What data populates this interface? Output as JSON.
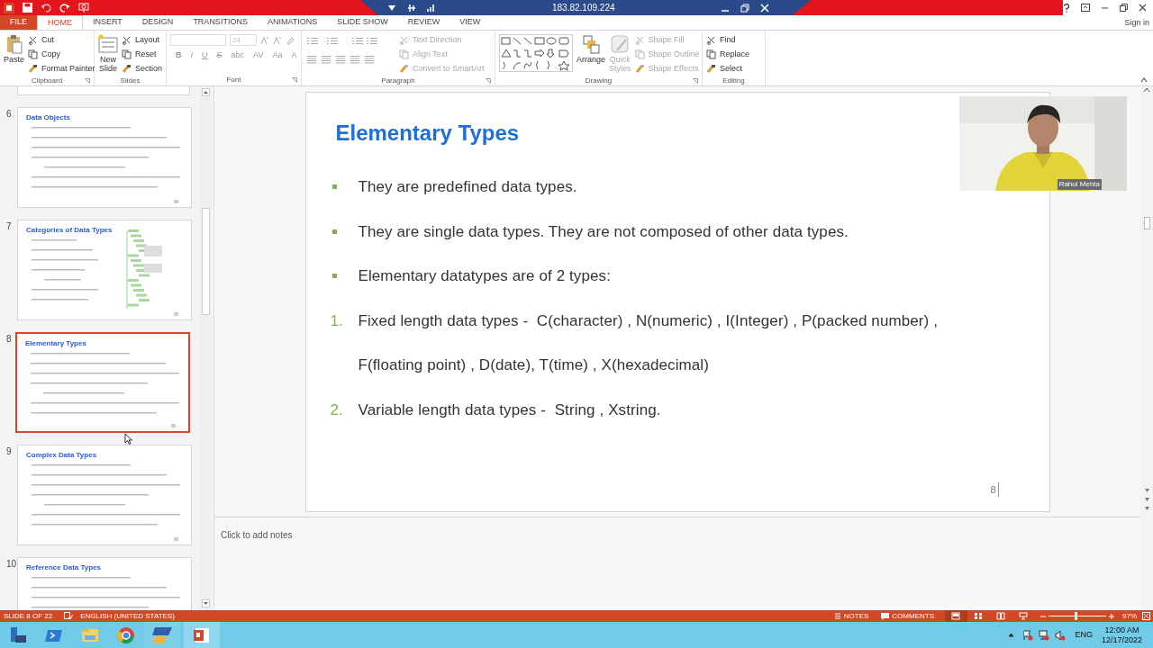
{
  "title_bar": {
    "remote_address": "183.82.109.224",
    "account": "Sign in"
  },
  "ribbon_tabs": [
    {
      "label": "FILE",
      "kind": "file",
      "selected": false
    },
    {
      "label": "HOME",
      "kind": "tab",
      "selected": true
    },
    {
      "label": "INSERT",
      "kind": "tab",
      "selected": false
    },
    {
      "label": "DESIGN",
      "kind": "tab",
      "selected": false
    },
    {
      "label": "TRANSITIONS",
      "kind": "tab",
      "selected": false
    },
    {
      "label": "ANIMATIONS",
      "kind": "tab",
      "selected": false
    },
    {
      "label": "SLIDE SHOW",
      "kind": "tab",
      "selected": false
    },
    {
      "label": "REVIEW",
      "kind": "tab",
      "selected": false
    },
    {
      "label": "VIEW",
      "kind": "tab",
      "selected": false
    }
  ],
  "ribbon_groups": [
    {
      "name": "Clipboard",
      "kind": "standard",
      "items": [
        {
          "kind": "large",
          "label": "Paste",
          "disabled": false
        },
        {
          "kind": "small",
          "label": "Cut",
          "disabled": false
        },
        {
          "kind": "small",
          "label": "Copy",
          "disabled": false
        },
        {
          "kind": "small",
          "label": "Format Painter",
          "disabled": false
        }
      ]
    },
    {
      "name": "Slides",
      "kind": "standard",
      "items": [
        {
          "kind": "large",
          "label": "New Slide",
          "disabled": false
        },
        {
          "kind": "small",
          "label": "Layout",
          "disabled": false
        },
        {
          "kind": "small",
          "label": "Reset",
          "disabled": false
        },
        {
          "kind": "small",
          "label": "Section",
          "disabled": false
        }
      ]
    },
    {
      "name": "Font",
      "kind": "font",
      "font_size": "24",
      "glyphs": [
        "B",
        "I",
        "U",
        "S",
        "abc",
        "AV",
        "Aa",
        "A"
      ]
    },
    {
      "name": "Paragraph",
      "kind": "paragraph",
      "items": [
        {
          "kind": "small",
          "label": "Text Direction",
          "disabled": true
        },
        {
          "kind": "small",
          "label": "Align Text",
          "disabled": true
        },
        {
          "kind": "small",
          "label": "Convert to SmartArt",
          "disabled": true
        }
      ]
    },
    {
      "name": "Drawing",
      "kind": "drawing",
      "items": [
        {
          "kind": "large",
          "label": "Arrange",
          "disabled": false
        },
        {
          "kind": "large",
          "label": "Quick Styles",
          "disabled": true
        },
        {
          "kind": "small",
          "label": "Shape Fill",
          "disabled": true
        },
        {
          "kind": "small",
          "label": "Shape Outline",
          "disabled": true
        },
        {
          "kind": "small",
          "label": "Shape Effects",
          "disabled": true
        }
      ]
    },
    {
      "name": "Editing",
      "kind": "standard",
      "items": [
        {
          "kind": "small",
          "label": "Find",
          "disabled": false
        },
        {
          "kind": "small",
          "label": "Replace",
          "disabled": false
        },
        {
          "kind": "small",
          "label": "Select",
          "disabled": false
        }
      ]
    }
  ],
  "thumbnails": [
    {
      "number": "6",
      "title": "Data Objects",
      "kind": "text",
      "selected": false
    },
    {
      "number": "7",
      "title": "Categories of Data Types",
      "kind": "diagram",
      "selected": false
    },
    {
      "number": "8",
      "title": "Elementary Types",
      "kind": "text",
      "selected": true
    },
    {
      "number": "9",
      "title": "Complex Data Types",
      "kind": "text",
      "selected": false
    },
    {
      "number": "10",
      "title": "Reference Data Types",
      "kind": "text",
      "selected": false
    }
  ],
  "slide": {
    "title": "Elementary Types",
    "page_number": "8",
    "items": [
      {
        "kind": "bullet",
        "text": "They are predefined data types."
      },
      {
        "kind": "bullet",
        "text": "They are single data types. They are not composed of other data types."
      },
      {
        "kind": "bullet",
        "text": "Elementary datatypes are of 2 types:"
      },
      {
        "kind": "numbered",
        "marker": "1.",
        "text": "Fixed length data types -  C(character) , N(numeric) , I(Integer) , P(packed number) ,"
      },
      {
        "kind": "continuation",
        "text": "F(floating point) , D(date), T(time) , X(hexadecimal)"
      },
      {
        "kind": "numbered",
        "marker": "2.",
        "text": "Variable length data types -  String , Xstring."
      }
    ]
  },
  "webcam": {
    "kind": "picture",
    "caption": "Rahul Mehta"
  },
  "notes": {
    "placeholder": "Click to add notes"
  },
  "status_bar": {
    "slide_info": "SLIDE 8 OF 22",
    "language": "ENGLISH (UNITED STATES)",
    "notes": "NOTES",
    "comments": "COMMENTS",
    "views": [
      {
        "selected": true
      },
      {
        "selected": false
      },
      {
        "selected": false
      },
      {
        "selected": false
      }
    ],
    "zoom": {
      "level": 0.48,
      "reading": "97%"
    }
  },
  "taskbar": {
    "apps": [
      {
        "selected": false
      },
      {
        "selected": false
      },
      {
        "selected": false
      },
      {
        "selected": false
      },
      {
        "selected": false
      },
      {
        "selected": true
      }
    ],
    "language": "ENG",
    "time": "12:00 AM",
    "date": "12/17/2022"
  }
}
